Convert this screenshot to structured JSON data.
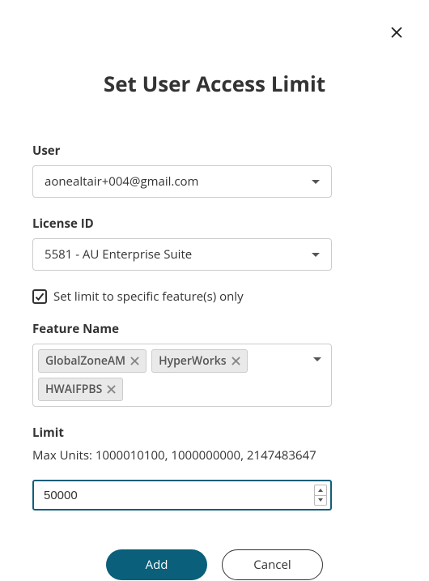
{
  "dialog": {
    "title": "Set User Access Limit"
  },
  "user": {
    "label": "User",
    "value": "aonealtair+004@gmail.com"
  },
  "license": {
    "label": "License ID",
    "value": "5581 - AU Enterprise Suite"
  },
  "specific_checkbox": {
    "label": "Set limit to specific feature(s) only",
    "checked": true
  },
  "feature": {
    "label": "Feature Name",
    "chips": [
      "GlobalZoneAM",
      "HyperWorks",
      "HWAIFPBS"
    ]
  },
  "limit": {
    "label": "Limit",
    "max_units_text": "Max Units: 1000010100, 1000000000, 2147483647",
    "value": "50000"
  },
  "buttons": {
    "add": "Add",
    "cancel": "Cancel"
  }
}
